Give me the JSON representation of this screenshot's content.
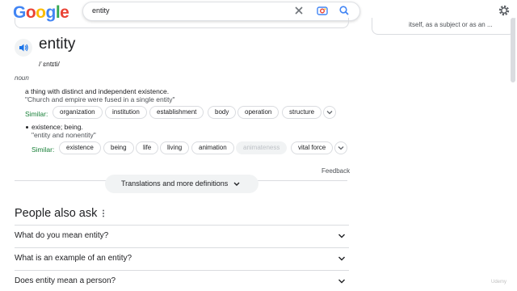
{
  "header": {
    "logo_letters": [
      {
        "ch": "G",
        "color": "#4285F4"
      },
      {
        "ch": "o",
        "color": "#EA4335"
      },
      {
        "ch": "o",
        "color": "#FBBC05"
      },
      {
        "ch": "g",
        "color": "#4285F4"
      },
      {
        "ch": "l",
        "color": "#34A853"
      },
      {
        "ch": "e",
        "color": "#EA4335"
      }
    ],
    "search_value": "entity",
    "icons": [
      "close-icon",
      "camera-search-icon",
      "search-icon",
      "settings-gear-icon"
    ]
  },
  "right_panel": {
    "snippet": "itself, as a subject or as an ..."
  },
  "dictionary": {
    "word": "entity",
    "phonetic": "/ˈɛntɪti/",
    "part_of_speech": "noun",
    "senses": [
      {
        "definition": "a thing with distinct and independent existence.",
        "example": "\"Church and empire were fused in a single entity\"",
        "similar_label": "Similar:",
        "similar": [
          "organization",
          "institution",
          "establishment",
          "body",
          "operation",
          "structure"
        ],
        "dimmed": []
      },
      {
        "definition": "existence; being.",
        "example": "\"entity and nonentity\"",
        "similar_label": "Similar:",
        "similar": [
          "existence",
          "being",
          "life",
          "living",
          "animation",
          "animateness",
          "vital force"
        ],
        "dimmed": [
          "animateness"
        ]
      }
    ],
    "feedback": "Feedback",
    "translations_button": "Translations and more definitions"
  },
  "people_also_ask": {
    "title": "People also ask",
    "questions": [
      "What do you mean entity?",
      "What is an example of an entity?",
      "Does entity mean a person?"
    ]
  },
  "watermark": "Udemy",
  "colors": {
    "similar_green": "#188038",
    "border": "#dadce0",
    "chip_dim_bg": "#f1f3f4",
    "text": "#202124",
    "secondary_text": "#4d5156"
  }
}
